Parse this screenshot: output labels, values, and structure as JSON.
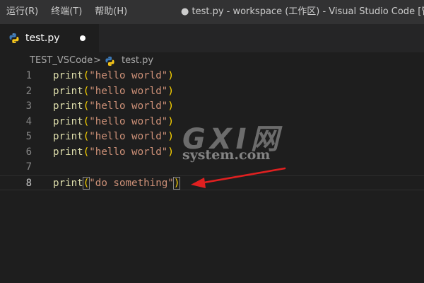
{
  "menu": {
    "items": [
      "运行(R)",
      "终端(T)",
      "帮助(H)"
    ]
  },
  "window": {
    "title": "● test.py - workspace (工作区) - Visual Studio Code [管理员]"
  },
  "tab": {
    "label": "test.py"
  },
  "breadcrumb": {
    "folder": "TEST_VSCode",
    "separator": ">",
    "file": "test.py"
  },
  "editor": {
    "lines": [
      {
        "num": "1",
        "fn": "print",
        "open": "(",
        "str": "\"hello world\"",
        "close": ")"
      },
      {
        "num": "2",
        "fn": "print",
        "open": "(",
        "str": "\"hello world\"",
        "close": ")"
      },
      {
        "num": "3",
        "fn": "print",
        "open": "(",
        "str": "\"hello world\"",
        "close": ")"
      },
      {
        "num": "4",
        "fn": "print",
        "open": "(",
        "str": "\"hello world\"",
        "close": ")"
      },
      {
        "num": "5",
        "fn": "print",
        "open": "(",
        "str": "\"hello world\"",
        "close": ")"
      },
      {
        "num": "6",
        "fn": "print",
        "open": "(",
        "str": "\"hello world\"",
        "close": ")"
      },
      {
        "num": "7"
      },
      {
        "num": "8",
        "fn": "print",
        "open": "(",
        "str": "\"do something\"",
        "close": ")"
      }
    ],
    "current_line": "8"
  },
  "watermark": {
    "brand": "GXI网",
    "site": "system.com"
  },
  "colors": {
    "function": "#dcdcaa",
    "bracket": "#ffd700",
    "string": "#ce9178",
    "line_number": "#858585",
    "arrow": "#e02020"
  },
  "icons": {
    "tab_file": "python-icon",
    "breadcrumb_file": "python-icon",
    "annotation": "red-arrow-icon"
  }
}
